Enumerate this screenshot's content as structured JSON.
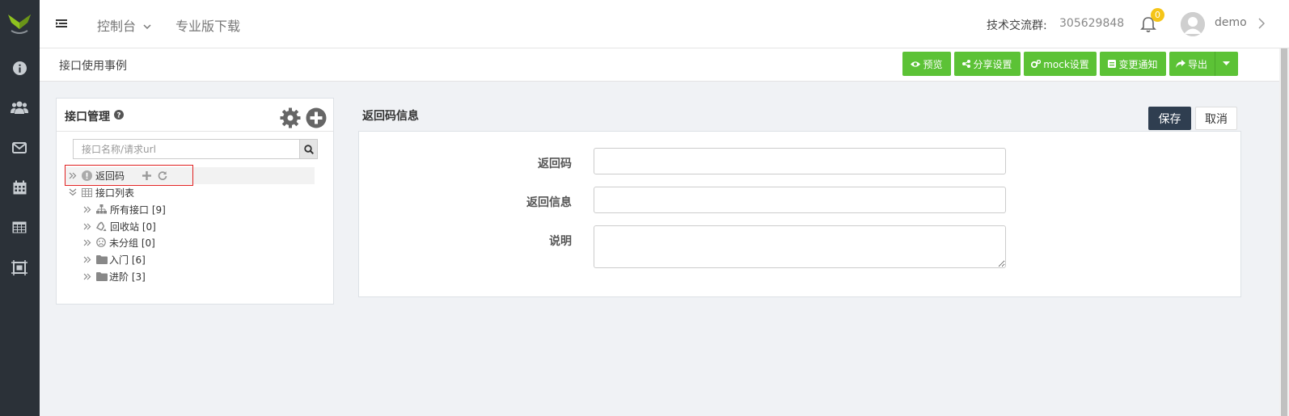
{
  "header": {
    "nav_console": "控制台",
    "nav_pro_download": "专业版下载",
    "qq_label": "技术交流群:",
    "qq_value": "305629848",
    "notification_count": "0",
    "user_name": "demo"
  },
  "sidebar": {
    "icons": [
      "info-icon",
      "users-icon",
      "envelope-icon",
      "calendar-icon",
      "table-icon",
      "frame-icon"
    ],
    "bg_color": "#2b3138",
    "logo_color": "#8fc31f"
  },
  "subheader": {
    "title": "接口使用事例",
    "buttons": {
      "preview": "预览",
      "share": "分享设置",
      "mock": "mock设置",
      "notify": "变更通知",
      "export": "导出"
    },
    "button_color": "#5cc236"
  },
  "tree": {
    "title": "接口管理",
    "search_placeholder": "接口名称/请求url",
    "items": [
      {
        "label": "返回码",
        "icon": "exclamation-circle-icon"
      },
      {
        "label": "接口列表",
        "icon": "table-icon"
      },
      {
        "label": "所有接口 [9]",
        "icon": "sitemap-icon"
      },
      {
        "label": "回收站 [0]",
        "icon": "recycle-icon"
      },
      {
        "label": "未分组 [0]",
        "icon": "frown-icon"
      },
      {
        "label": "入门 [6]",
        "icon": "folder-icon"
      },
      {
        "label": "进阶 [3]",
        "icon": "folder-icon"
      }
    ]
  },
  "form": {
    "title": "返回码信息",
    "save_label": "保存",
    "cancel_label": "取消",
    "field_code_label": "返回码",
    "field_code_value": "",
    "field_message_label": "返回信息",
    "field_message_value": "",
    "field_desc_label": "说明",
    "field_desc_value": "",
    "save_color": "#2f3e50"
  }
}
